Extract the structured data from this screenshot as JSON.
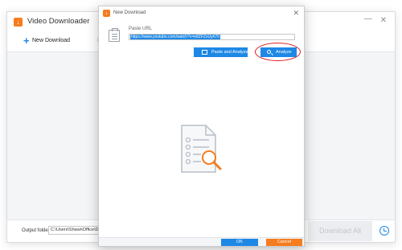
{
  "main_window": {
    "title": "Video Downloader",
    "logo": "↓",
    "minimize_glyph": "—",
    "close_glyph": "✕",
    "toolbar": {
      "new_download_icon": "+",
      "new_download_label": "New Download",
      "right_tool_text": "I"
    },
    "footer": {
      "output_folder_label": "Output folder:",
      "output_folder_value": "C:\\Users\\ShawnOffice\\Docume",
      "download_all_label": "Download All"
    }
  },
  "dialog": {
    "title": "New Download",
    "logo": "↓",
    "close_glyph": "✕",
    "paste_url_label": "Paste URL",
    "url_value": "https://www.youtube.com/watch?v=e8ZFZxUyh70",
    "paste_analyze_label": "Paste and Analyze",
    "analyze_label": "Analyze",
    "ok_label": "OK",
    "cancel_label": "Cancel"
  },
  "colors": {
    "accent_blue": "#1e88e5",
    "accent_orange": "#f57c1f",
    "highlight_red": "#e01c24"
  },
  "icons": [
    "download-logo-icon",
    "plus-icon",
    "paste-icon",
    "search-icon",
    "document-search-icon",
    "alarm-clock-icon"
  ]
}
